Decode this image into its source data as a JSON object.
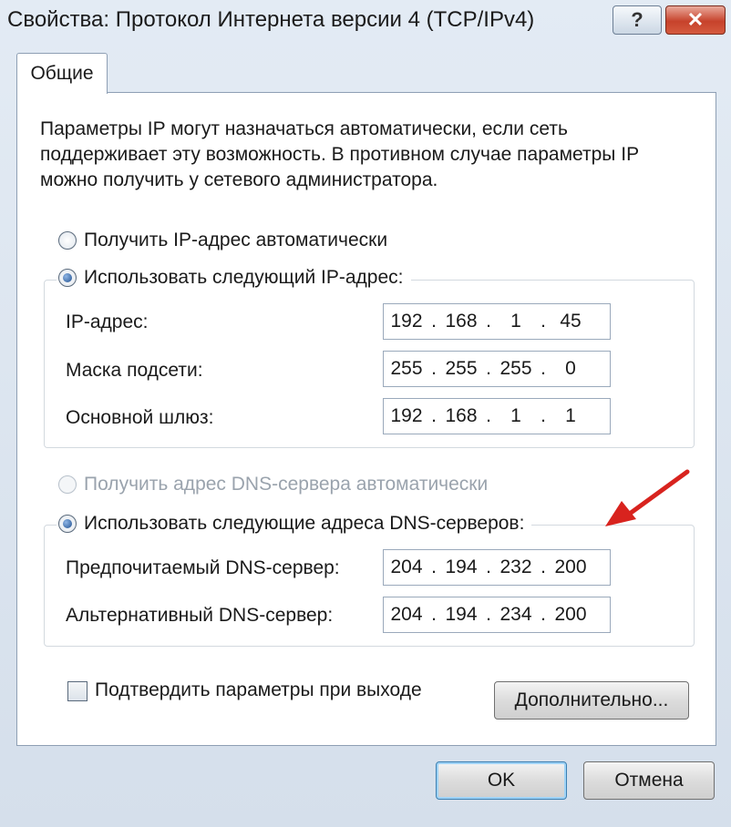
{
  "window": {
    "title": "Свойства: Протокол Интернета версии 4 (TCP/IPv4)",
    "help_label": "?",
    "close_label": "✕"
  },
  "tab": {
    "label": "Общие"
  },
  "description": "Параметры IP могут назначаться автоматически, если сеть поддерживает эту возможность. В противном случае параметры IP можно получить у сетевого администратора.",
  "ip_section": {
    "auto_label": "Получить IP-адрес автоматически",
    "manual_label": "Использовать следующий IP-адрес:",
    "fields": [
      {
        "label": "IP-адрес:",
        "octets": [
          "192",
          "168",
          "1",
          "45"
        ]
      },
      {
        "label": "Маска подсети:",
        "octets": [
          "255",
          "255",
          "255",
          "0"
        ]
      },
      {
        "label": "Основной шлюз:",
        "octets": [
          "192",
          "168",
          "1",
          "1"
        ]
      }
    ]
  },
  "dns_section": {
    "auto_label": "Получить адрес DNS-сервера автоматически",
    "manual_label": "Использовать следующие адреса DNS-серверов:",
    "fields": [
      {
        "label": "Предпочитаемый DNS-сервер:",
        "octets": [
          "204",
          "194",
          "232",
          "200"
        ]
      },
      {
        "label": "Альтернативный DNS-сервер:",
        "octets": [
          "204",
          "194",
          "234",
          "200"
        ]
      }
    ]
  },
  "validate_label": "Подтвердить параметры при выходе",
  "buttons": {
    "advanced": "Дополнительно...",
    "ok": "OK",
    "cancel": "Отмена"
  },
  "colors": {
    "arrow": "#d8231e",
    "accent": "#1f4f8f"
  }
}
